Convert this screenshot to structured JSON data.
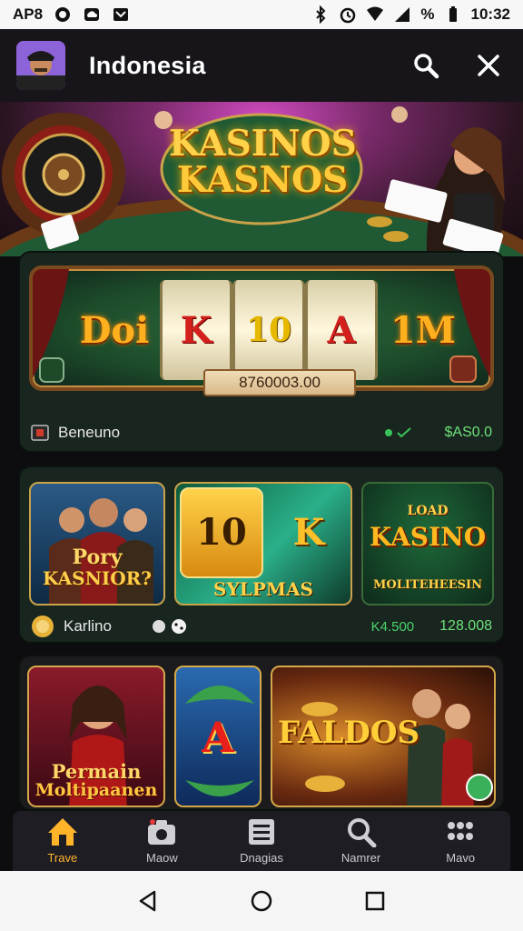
{
  "status_bar": {
    "left_text": "AP8",
    "time": "10:32",
    "battery_text": "%"
  },
  "app_bar": {
    "title": "Indonesia",
    "icons": [
      "search-icon",
      "close-icon"
    ]
  },
  "hero": {
    "logo_line1": "KASINOS",
    "logo_line2": "KASNOS"
  },
  "featured_slot": {
    "reels": [
      "Doi",
      "K",
      "10",
      "A",
      "1M"
    ],
    "amount": "8760003.00",
    "footer_label": "Beneuno",
    "footer_value": "$AS0.0"
  },
  "games_row1": {
    "tiles": [
      {
        "line1": "Pory",
        "line2": "KASNIOR?"
      },
      {
        "line1": "10",
        "line2": "K",
        "line3": "SYLPMAS"
      },
      {
        "line1": "LOAD",
        "line2": "KASINO",
        "line3": "MOLITEHEESIN"
      }
    ],
    "footer_label": "Karlino",
    "footer_mid": "K4.500",
    "footer_value": "128.008"
  },
  "games_row2": {
    "tiles": [
      {
        "line1": "Permain",
        "line2": "Moltipaanen"
      },
      {
        "line1": "A"
      },
      {
        "line1": "FALDOS"
      }
    ]
  },
  "bottom_nav": [
    {
      "label": "Trave",
      "icon": "home-icon",
      "active": true
    },
    {
      "label": "Maow",
      "icon": "camera-icon",
      "active": false
    },
    {
      "label": "Dnagias",
      "icon": "list-icon",
      "active": false
    },
    {
      "label": "Namrer",
      "icon": "search-icon",
      "active": false
    },
    {
      "label": "Mavo",
      "icon": "grid-icon",
      "active": false
    }
  ],
  "colors": {
    "accent": "#ffb42a",
    "card_green": "#18261f",
    "value_green": "#6fe07a"
  }
}
